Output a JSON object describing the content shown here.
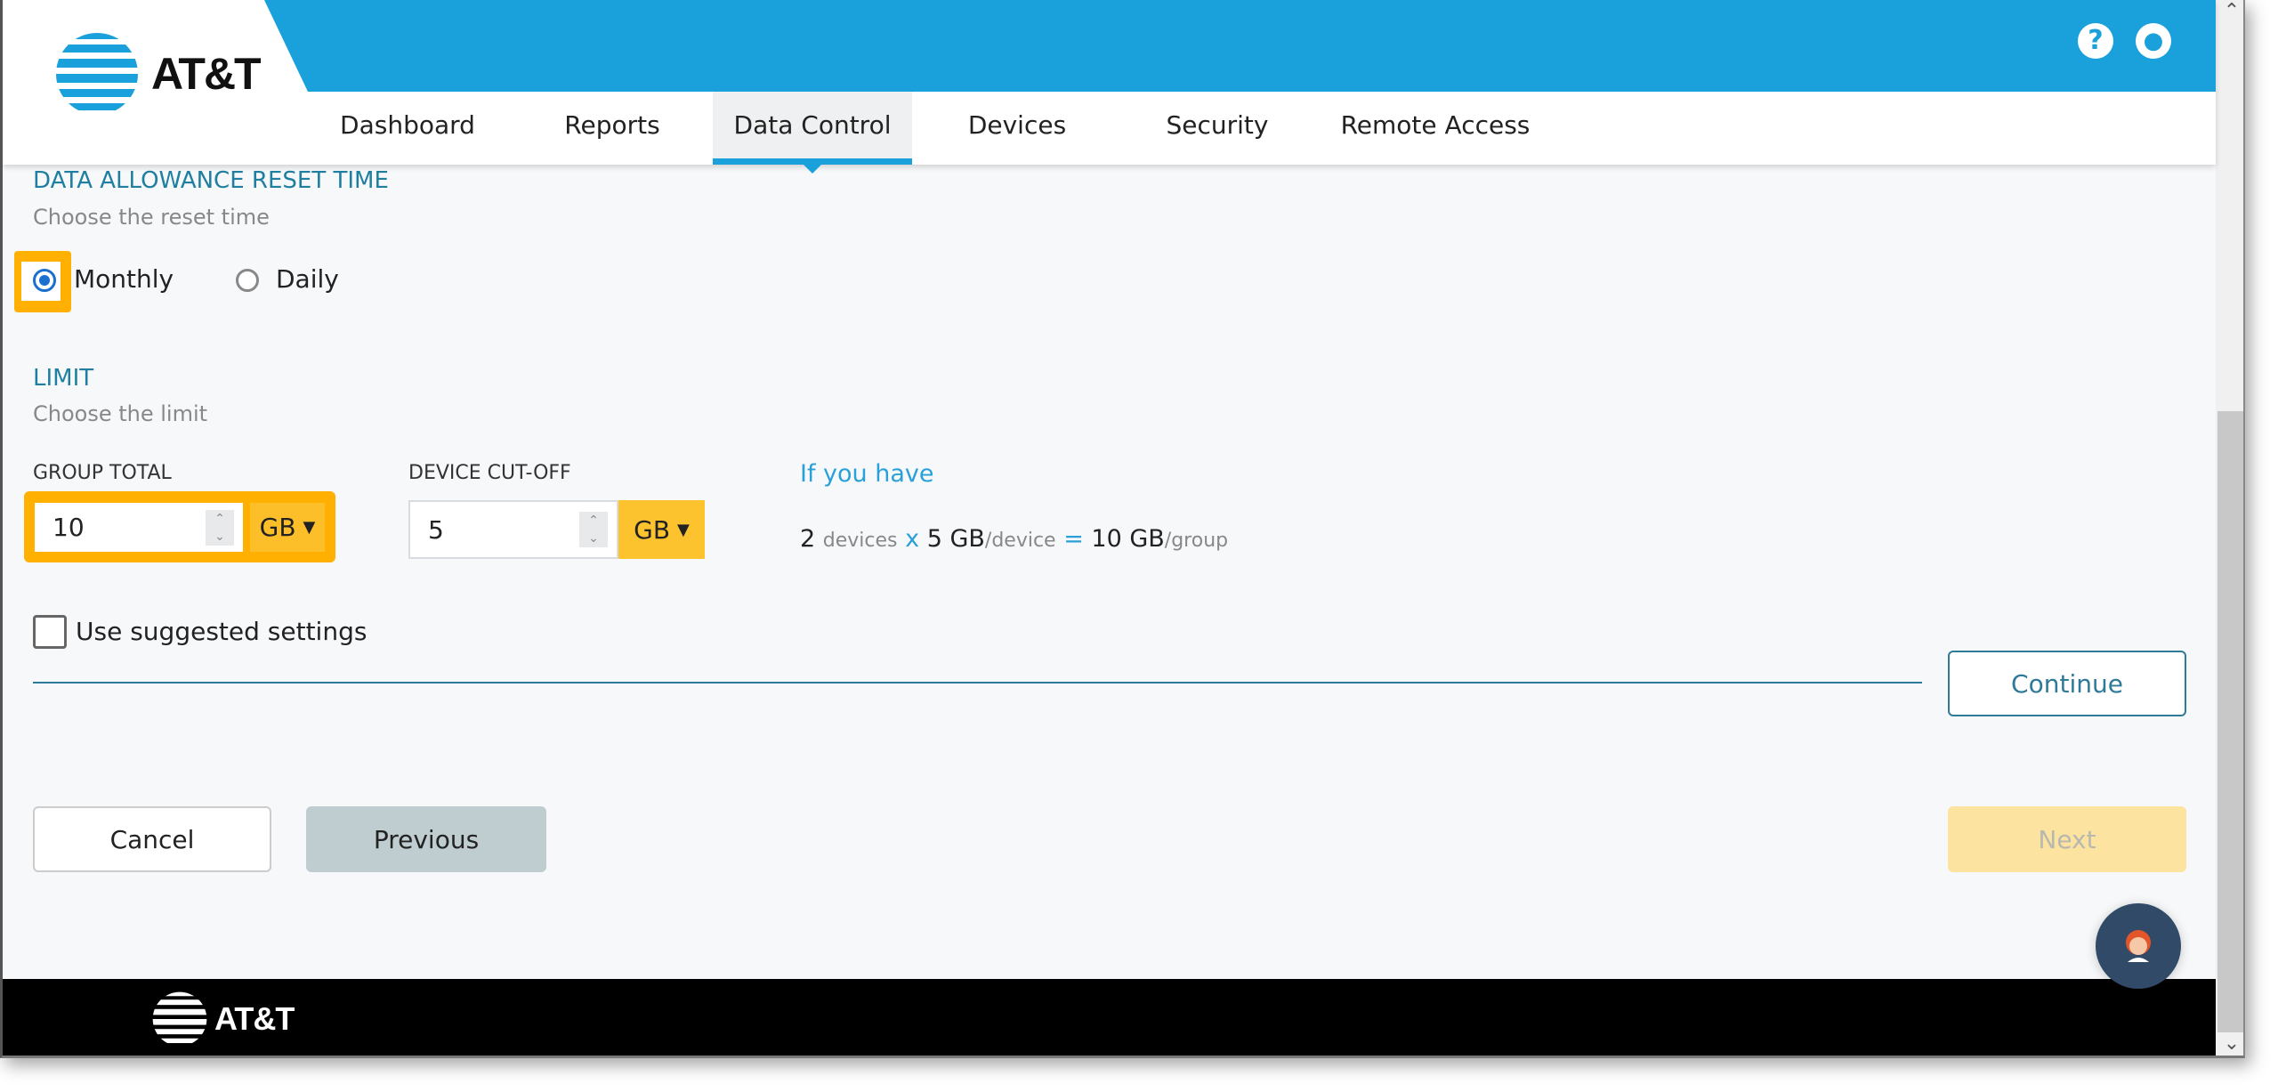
{
  "header": {
    "brand": "AT&T",
    "help_icon": "question-circle-icon",
    "user_icon": "user-circle-icon",
    "accent": "#1aa1db"
  },
  "nav": [
    {
      "label": "Dashboard"
    },
    {
      "label": "Reports"
    },
    {
      "label": "Data Control",
      "active": true
    },
    {
      "label": "Devices"
    },
    {
      "label": "Security"
    },
    {
      "label": "Remote Access"
    }
  ],
  "reset": {
    "title": "DATA ALLOWANCE RESET TIME",
    "subtitle": "Choose the reset time",
    "options": [
      {
        "label": "Monthly",
        "selected": true
      },
      {
        "label": "Daily",
        "selected": false
      }
    ]
  },
  "limit": {
    "title": "LIMIT",
    "subtitle": "Choose the limit",
    "group_total": {
      "label": "GROUP TOTAL",
      "value": "10",
      "unit": "GB"
    },
    "device_cutoff": {
      "label": "DEVICE CUT-OFF",
      "value": "5",
      "unit": "GB"
    },
    "info": {
      "heading": "If you have",
      "devices": "2",
      "devices_unit": "devices",
      "x": "x",
      "per_device": "5 GB",
      "per_device_unit": "/device",
      "eq": "=",
      "group": "10 GB",
      "group_unit": "/group"
    },
    "suggested": {
      "label": "Use suggested settings",
      "checked": false
    }
  },
  "buttons": {
    "continue": "Continue",
    "cancel": "Cancel",
    "previous": "Previous",
    "next": "Next"
  },
  "footer": {
    "brand": "AT&T"
  },
  "highlight_color": "#ffb000"
}
